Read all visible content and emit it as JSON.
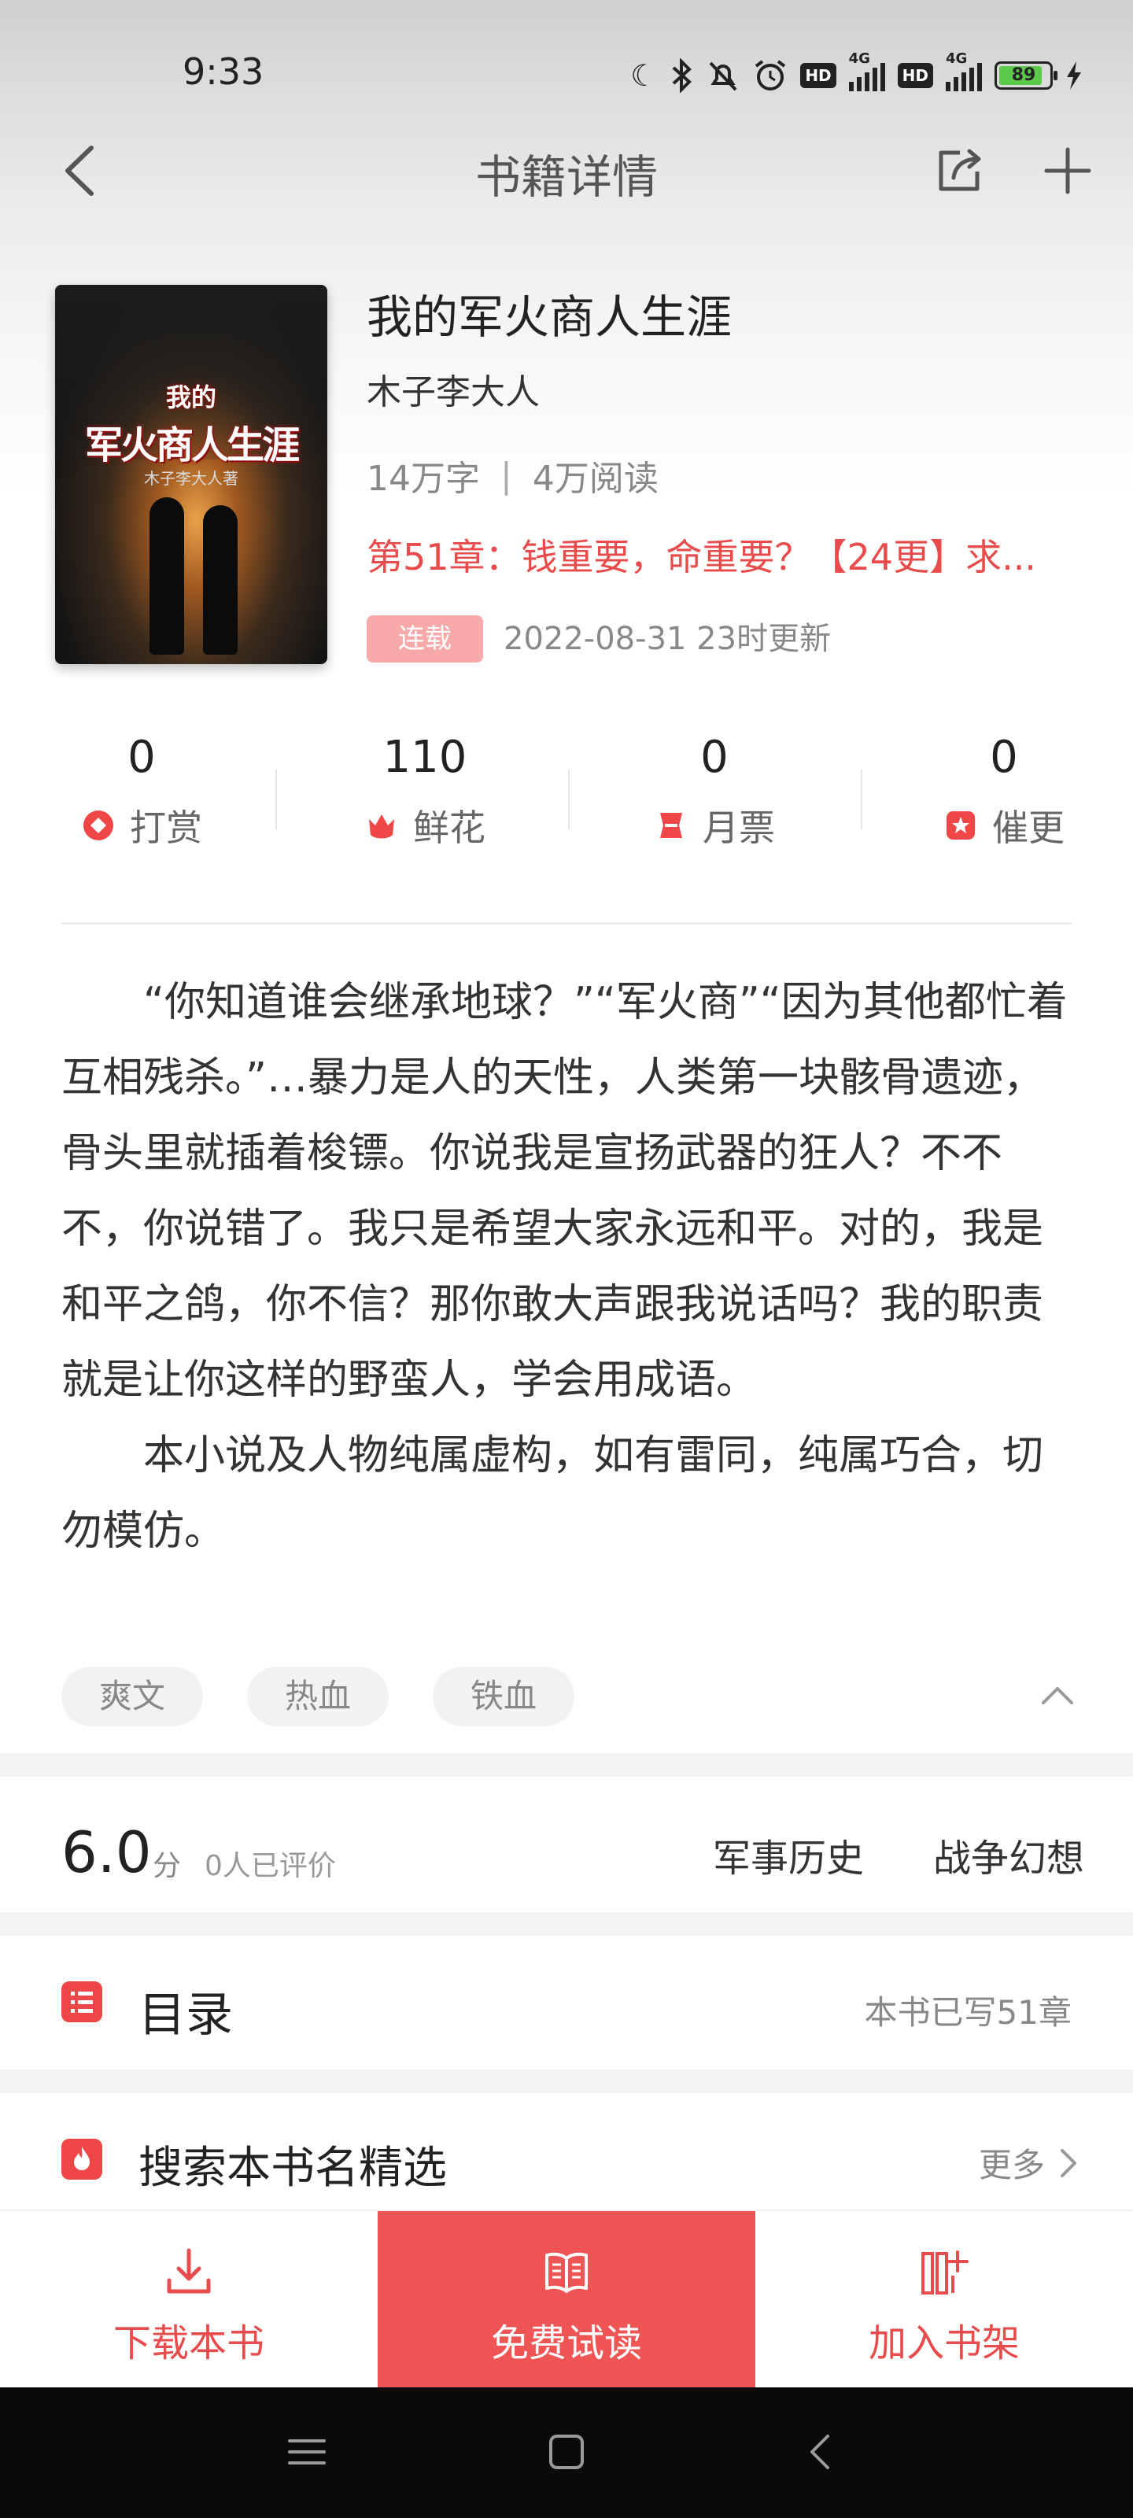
{
  "status_bar": {
    "time": "9:33",
    "network_1": "4G",
    "network_2": "4G",
    "hd_1": "HD",
    "hd_2": "HD",
    "battery": "89"
  },
  "navbar": {
    "title": "书籍详情"
  },
  "book": {
    "title": "我的军火商人生涯",
    "author": "木子李大人",
    "word_count": "14万字",
    "separator": "|",
    "reads": "4万阅读",
    "latest_chapter": "第51章：钱重要，命重要？【24更】求...",
    "status_tag": "连载",
    "updated": "2022-08-31 23时更新",
    "cover": {
      "small_text": "我的",
      "big_text": "军火商人生涯",
      "author_text": "木子李大人著"
    }
  },
  "stats": [
    {
      "value": "0",
      "label": "打赏",
      "icon": "reward-icon"
    },
    {
      "value": "110",
      "label": "鲜花",
      "icon": "flower-icon"
    },
    {
      "value": "0",
      "label": "月票",
      "icon": "ticket-icon"
    },
    {
      "value": "0",
      "label": "催更",
      "icon": "urge-icon"
    }
  ],
  "synopsis": {
    "p1": "“你知道谁会继承地球？”“军火商”“因为其他都忙着互相残杀。”…暴力是人的天性，人类第一块骸骨遗迹，骨头里就插着梭镖。你说我是宣扬武器的狂人？不不不，你说错了。我只是希望大家永远和平。对的，我是和平之鸽，你不信？那你敢大声跟我说话吗？我的职责就是让你这样的野蛮人，学会用成语。",
    "p2": "本小说及人物纯属虚构，如有雷同，纯属巧合，切勿模仿。"
  },
  "tags": [
    "爽文",
    "热血",
    "铁血"
  ],
  "rating": {
    "score": "6.0",
    "unit": "分",
    "count": "0人已评价",
    "categories": [
      "军事历史",
      "战争幻想"
    ]
  },
  "catalog": {
    "title": "目录",
    "info": "本书已写51章"
  },
  "search_featured": {
    "title": "搜索本书名精选",
    "more": "更多"
  },
  "actions": {
    "download": "下载本书",
    "read": "免费试读",
    "shelf": "加入书架"
  },
  "colors": {
    "accent": "#e84b4b",
    "read_button": "#f05555",
    "status_tag": "#f7a8a8"
  }
}
